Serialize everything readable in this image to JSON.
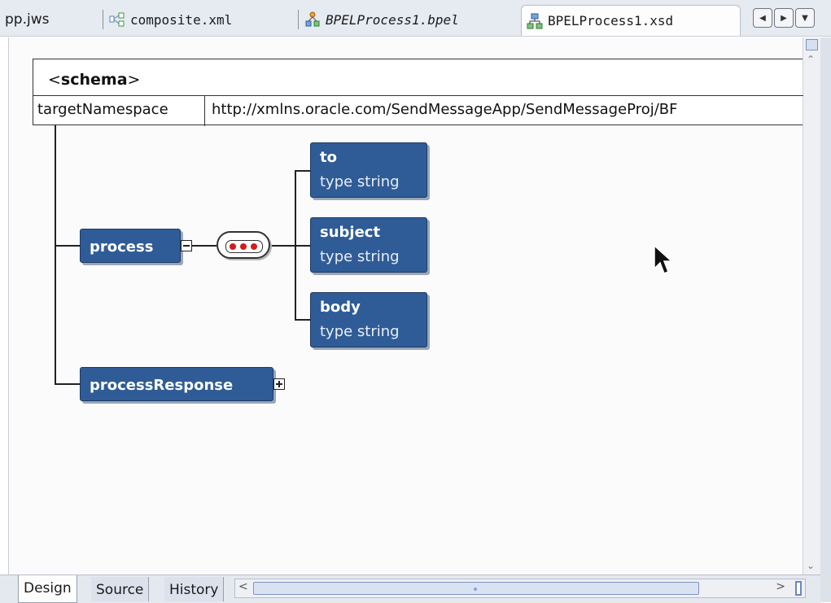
{
  "tabs": {
    "jws": "pp.jws",
    "composite": "composite.xml",
    "bpel": "BPELProcess1.bpel",
    "xsd": "BPELProcess1.xsd"
  },
  "schema": {
    "open": "<",
    "name": "schema",
    "close": ">",
    "ns_key": "targetNamespace",
    "ns_value": "http://xmlns.oracle.com/SendMessageApp/SendMessageProj/BF"
  },
  "elements": {
    "process": "process",
    "response": "processResponse",
    "children": [
      {
        "name": "to",
        "type": "type string"
      },
      {
        "name": "subject",
        "type": "type string"
      },
      {
        "name": "body",
        "type": "type string"
      }
    ]
  },
  "bottom_tabs": [
    "Design",
    "Source",
    "History"
  ],
  "colors": {
    "node": "#2f5c96",
    "sequence_dot": "#d41c1c"
  }
}
